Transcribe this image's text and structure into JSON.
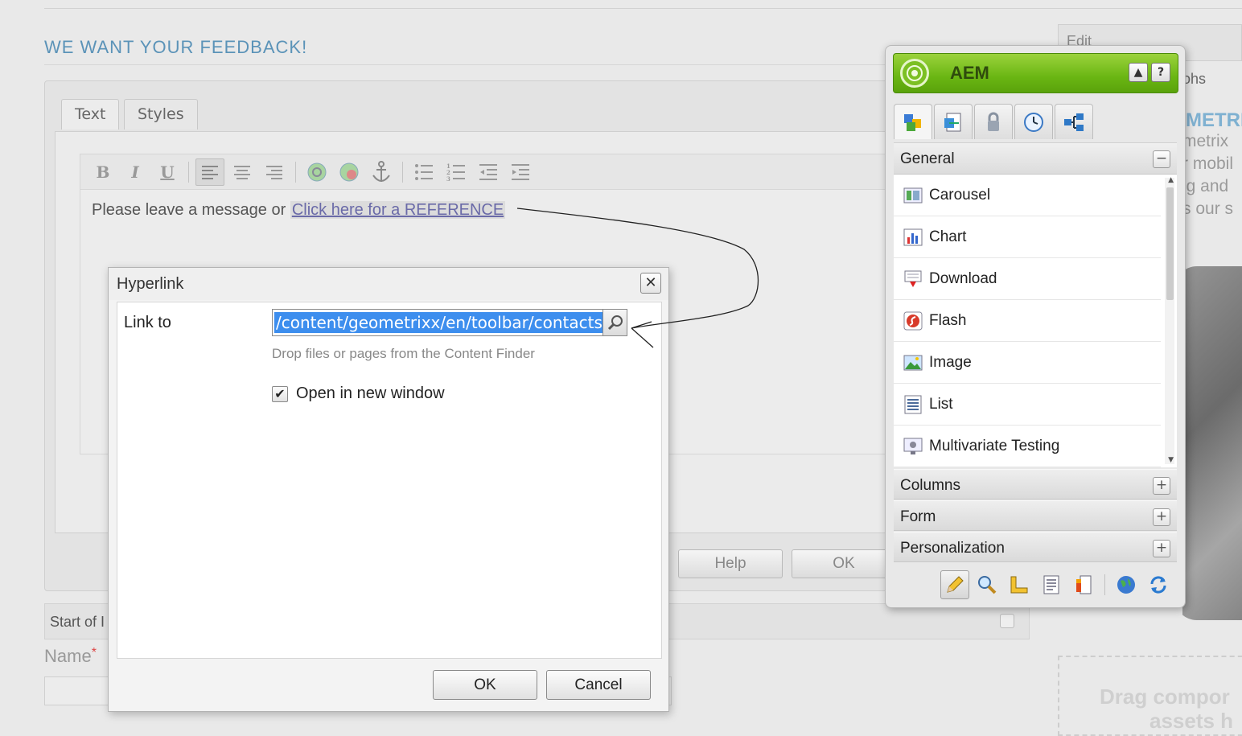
{
  "page": {
    "heading": "WE WANT YOUR FEEDBACK!"
  },
  "rte": {
    "tabs": [
      "Text",
      "Styles"
    ],
    "editor_text": "Please leave a message or ",
    "editor_link": "Click here for a REFERENCE",
    "buttons": {
      "help": "Help",
      "ok": "OK"
    }
  },
  "form": {
    "start_label": "Start of I",
    "name_label": "Name",
    "required_mark": "*"
  },
  "right_column": {
    "edit_tab": "Edit",
    "ohs_text": "ohs",
    "brand_fragment": "METRI",
    "text_lines": [
      "metrix",
      "r mobil",
      "ig and",
      "s our s"
    ],
    "drag_text_line1": "Drag compor",
    "drag_text_line2": "assets h"
  },
  "hyperlink_dialog": {
    "title": "Hyperlink",
    "link_label": "Link to",
    "link_value": "/content/geometrixx/en/toolbar/contacts.ht",
    "hint": "Drop files or pages from the Content Finder",
    "open_new_window_label": "Open in new window",
    "open_new_window_checked": true,
    "ok_label": "OK",
    "cancel_label": "Cancel",
    "close_glyph": "✕"
  },
  "sidekick": {
    "title": "AEM",
    "header_buttons": [
      "▲",
      "?"
    ],
    "tabs": [
      "components-tab",
      "page-tab",
      "versioning-tab",
      "workflow-tab",
      "structure-tab"
    ],
    "groups": {
      "general": "General",
      "columns": "Columns",
      "form": "Form",
      "personalization": "Personalization"
    },
    "toggles": {
      "expanded": "−",
      "collapsed": "+"
    },
    "components": [
      {
        "label": "Carousel",
        "icon": "carousel-icon"
      },
      {
        "label": "Chart",
        "icon": "chart-icon"
      },
      {
        "label": "Download",
        "icon": "download-icon"
      },
      {
        "label": "Flash",
        "icon": "flash-icon"
      },
      {
        "label": "Image",
        "icon": "image-icon"
      },
      {
        "label": "List",
        "icon": "list-icon"
      },
      {
        "label": "Multivariate Testing",
        "icon": "multivariate-testing-icon"
      }
    ],
    "footer_tools": [
      "edit-mode-icon",
      "preview-mode-icon",
      "design-mode-icon",
      "properties-icon",
      "activate-icon",
      "website-icon",
      "refresh-icon"
    ]
  },
  "colors": {
    "heading": "#5b93b8",
    "selection": "#3d8eee",
    "sidekick_green": "#6ab613"
  }
}
